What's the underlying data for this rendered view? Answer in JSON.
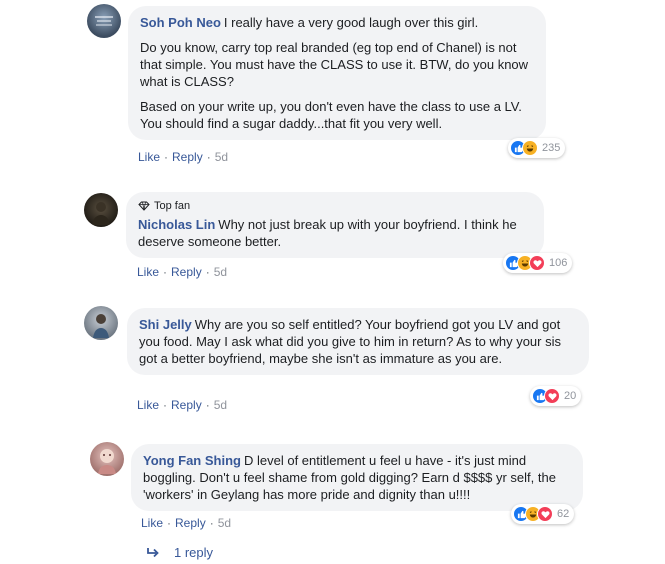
{
  "comments": [
    {
      "author": "Soh Poh Neo",
      "paragraphs": [
        "I really have a very good laugh over this girl.",
        "Do you know, carry top real branded (eg top end of Chanel) is not that simple. You must have the CLASS to use it. BTW, do you know what is CLASS?",
        "Based on your write up, you don't even have the class to use a LV. You should find a sugar daddy...that fit you very well."
      ],
      "like": "Like",
      "reply": "Reply",
      "time": "5d",
      "reaction_count": "235",
      "reaction_icons": [
        "like-icon",
        "haha-icon"
      ]
    },
    {
      "badge": "Top fan",
      "author": "Nicholas Lin",
      "paragraphs": [
        "Why not just break up with your boyfriend. I think he deserve someone better."
      ],
      "like": "Like",
      "reply": "Reply",
      "time": "5d",
      "reaction_count": "106",
      "reaction_icons": [
        "like-icon",
        "haha-icon",
        "love-icon"
      ]
    },
    {
      "author": "Shi Jelly",
      "paragraphs": [
        "Why are you so self entitled? Your boyfriend got you LV and got you food. May I ask what did you give to him in return? As to why your sis got a better boyfriend, maybe she isn't as immature as you are."
      ],
      "like": "Like",
      "reply": "Reply",
      "time": "5d",
      "reaction_count": "20",
      "reaction_icons": [
        "like-icon",
        "love-icon"
      ]
    },
    {
      "author": "Yong Fan Shing",
      "paragraphs": [
        "D level of entitlement u feel u have - it's just mind boggling. Don't u feel shame from gold digging? Earn d $$$$ yr self, the 'workers' in Geylang has more pride and dignity than u!!!!"
      ],
      "like": "Like",
      "reply": "Reply",
      "time": "5d",
      "reaction_count": "62",
      "reaction_icons": [
        "like-icon",
        "haha-icon",
        "love-icon"
      ]
    }
  ],
  "replies_link": "1 reply",
  "colors": {
    "link": "#385898",
    "bubble": "#f2f3f5",
    "like": "#1877f2",
    "love": "#f33e58",
    "haha": "#f7b125"
  }
}
